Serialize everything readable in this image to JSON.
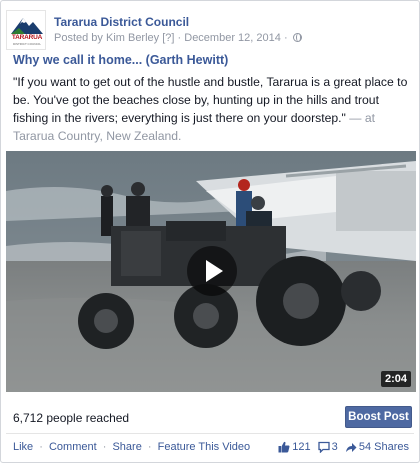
{
  "post": {
    "page_name": "Tararua District Council",
    "posted_by": "Posted by Kim Berley",
    "bracket": "[?]",
    "date_sep": "·",
    "date": "December 12, 2014",
    "date_sep2": "·",
    "text": "\"If you want to get out of the hustle and bustle, Tararua is a great place to be. You've got the beaches close by, hunting up in the hills and trout fishing in the rivers; everything is just there on your doorstep.\"",
    "tag": " — at Tararua Country, New Zealand."
  },
  "logo": {
    "word": "TARARUA",
    "sub": "DISTRICT COUNCIL"
  },
  "video": {
    "title": "Why we call it home... (Garth Hewitt)",
    "duration": "2:04"
  },
  "footer": {
    "reach": "6,712 people reached",
    "boost_label": "Boost Post",
    "actions": [
      "Like",
      "Comment",
      "Share",
      "Feature This Video"
    ],
    "separator": "·",
    "likes": "121",
    "comments": "3",
    "shares": "54 Shares"
  },
  "colors": {
    "link_blue": "#3b5998",
    "boost_blue": "#4e69a2",
    "meta_gray": "#9197a3",
    "logo_red": "#b5121b"
  },
  "icons": [
    "globe-icon",
    "play-icon",
    "like-icon",
    "comment-icon",
    "share-icon"
  ]
}
